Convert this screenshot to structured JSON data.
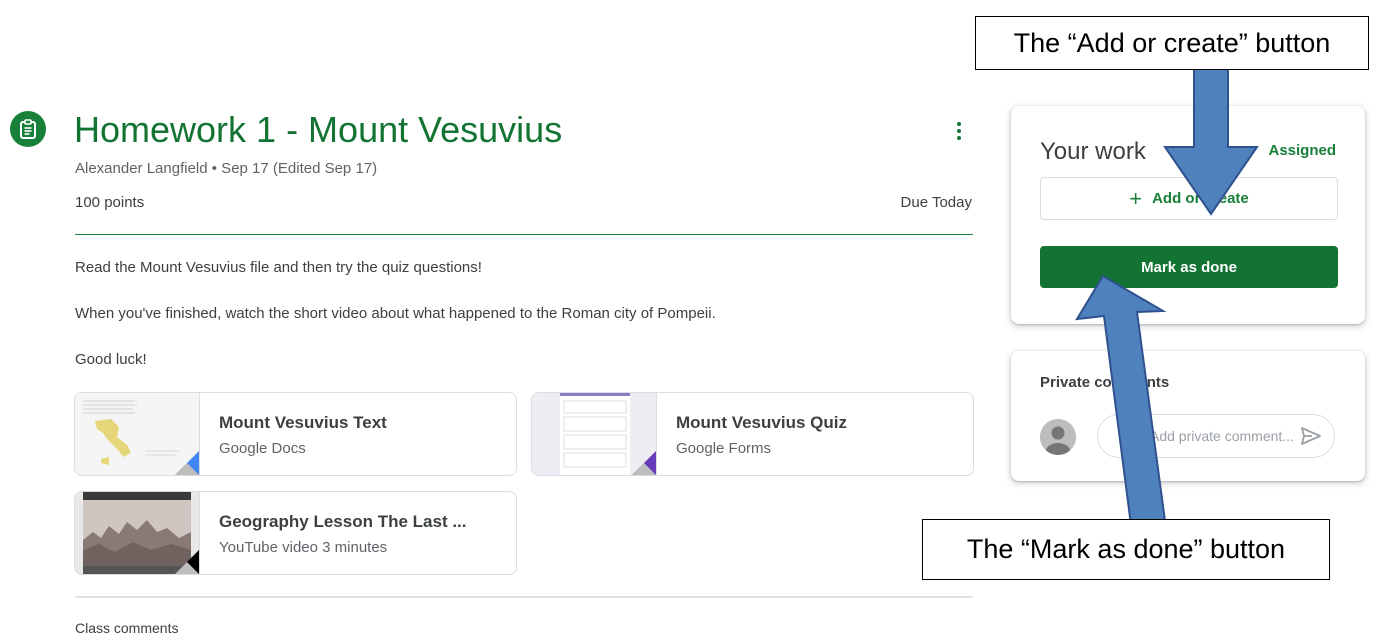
{
  "assignment": {
    "title": "Homework 1 - Mount Vesuvius",
    "meta": "Alexander Langfield • Sep 17 (Edited Sep 17)",
    "points": "100 points",
    "due": "Due Today",
    "instructions": [
      "Read the Mount Vesuvius file and then try the quiz questions!",
      "When you've finished, watch the short video about what happened to the Roman city of Pompeii.",
      "Good luck!"
    ]
  },
  "attachments": [
    {
      "title": "Mount Vesuvius Text",
      "subtitle": "Google Docs",
      "accent": "#4285f4"
    },
    {
      "title": "Mount Vesuvius Quiz",
      "subtitle": "Google Forms",
      "accent": "#673ab7"
    },
    {
      "title": "Geography Lesson The Last ...",
      "subtitle": "YouTube video   3 minutes",
      "accent": "#000000"
    }
  ],
  "class_comments_label": "Class comments",
  "your_work": {
    "title": "Your work",
    "status": "Assigned",
    "add_label": "Add or create",
    "add_icon": "plus-icon",
    "mark_done_label": "Mark as done"
  },
  "private_comments": {
    "title": "Private comments",
    "placeholder": "Add private comment..."
  },
  "annotations": {
    "add_callout": "The “Add or create” button",
    "done_callout": "The “Mark as done” button"
  },
  "colors": {
    "brand_green": "#137333",
    "accent_green": "#188038",
    "arrow_fill": "#4f81bd",
    "arrow_stroke": "#2f528f"
  }
}
